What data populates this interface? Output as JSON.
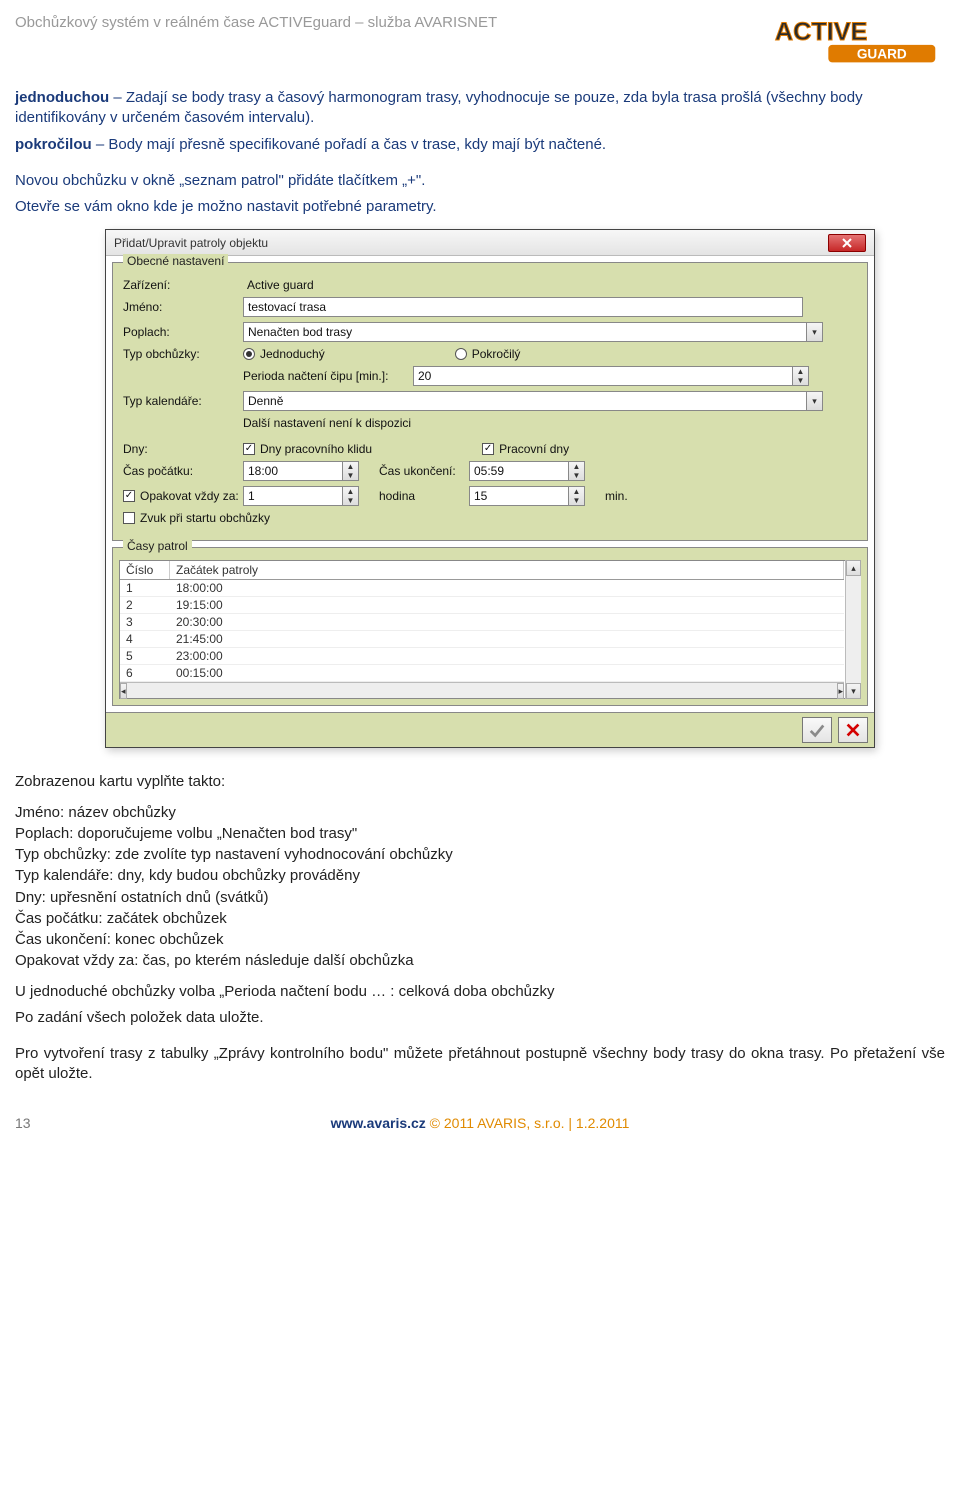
{
  "doc": {
    "header": "Obchůzkový systém v reálném čase ACTIVEguard – služba AVARISNET",
    "para1a": "jednoduchou",
    "para1b": " – Zadají se body trasy a časový harmonogram trasy, vyhodnocuje se pouze, zda byla trasa prošlá (všechny body identifikovány v určeném časovém intervalu).",
    "para2a": "pokročilou",
    "para2b": " – Body mají přesně specifikované pořadí a čas v trase, kdy mají být načtené.",
    "para3": "Novou obchůzku v okně „seznam patrol\" přidáte tlačítkem „+\".",
    "para4": "Otevře se vám okno kde je možno nastavit potřebné parametry.",
    "after1": "Zobrazenou kartu vyplňte takto:",
    "list": [
      "Jméno: název obchůzky",
      "Poplach: doporučujeme volbu „Nenačten bod trasy\"",
      "Typ obchůzky: zde zvolíte typ nastavení vyhodnocování obchůzky",
      "Typ kalendáře: dny, kdy budou obchůzky prováděny",
      "Dny: upřesnění ostatních dnů (svátků)",
      "Čas počátku: začátek obchůzek",
      "Čas ukončení: konec obchůzek",
      "Opakovat vždy za: čas, po kterém následuje další obchůzka"
    ],
    "after2": "U jednoduché obchůzky volba „Perioda načtení bodu … : celková doba obchůzky",
    "after3": "Po zadání všech položek data uložte.",
    "after4": "Pro vytvoření trasy z tabulky „Zprávy kontrolního bodu\" můžete přetáhnout postupně všechny body trasy do okna trasy. Po přetažení vše opět uložte."
  },
  "dialog": {
    "title": "Přidat/Upravit patroly objektu",
    "fs1": "Obecné nastavení",
    "labels": {
      "zarizeni": "Zařízení:",
      "zarizeni_val": "Active guard",
      "jmeno": "Jméno:",
      "jmeno_val": "testovací trasa",
      "poplach": "Poplach:",
      "poplach_val": "Nenačten bod trasy",
      "typob": "Typ obchůzky:",
      "r_jedn": "Jednoduchý",
      "r_pokr": "Pokročilý",
      "perioda": "Perioda načtení čipu [min.]:",
      "perioda_val": "20",
      "typkal": "Typ kalendáře:",
      "typkal_val": "Denně",
      "dalsi": "Další nastavení není k dispozici",
      "dny": "Dny:",
      "c_klid": "Dny pracovního klidu",
      "c_prac": "Pracovní dny",
      "caspoc": "Čas počátku:",
      "caspoc_val": "18:00",
      "casuk": "Čas ukončení:",
      "casuk_val": "05:59",
      "opak": "Opakovat vždy za:",
      "opak_val": "1",
      "hodina": "hodina",
      "opak2_val": "15",
      "min": "min.",
      "zvuk": "Zvuk při startu obchůzky"
    },
    "fs2": "Časy patrol",
    "columns": {
      "c1": "Číslo",
      "c2": "Začátek patroly"
    },
    "rows": [
      {
        "n": "1",
        "t": "18:00:00"
      },
      {
        "n": "2",
        "t": "19:15:00"
      },
      {
        "n": "3",
        "t": "20:30:00"
      },
      {
        "n": "4",
        "t": "21:45:00"
      },
      {
        "n": "5",
        "t": "23:00:00"
      },
      {
        "n": "6",
        "t": "00:15:00"
      }
    ]
  },
  "footer": {
    "page": "13",
    "url": "www.avaris.cz",
    "copy": " © 2011 AVARIS, s.r.o. | 1.2.2011"
  }
}
